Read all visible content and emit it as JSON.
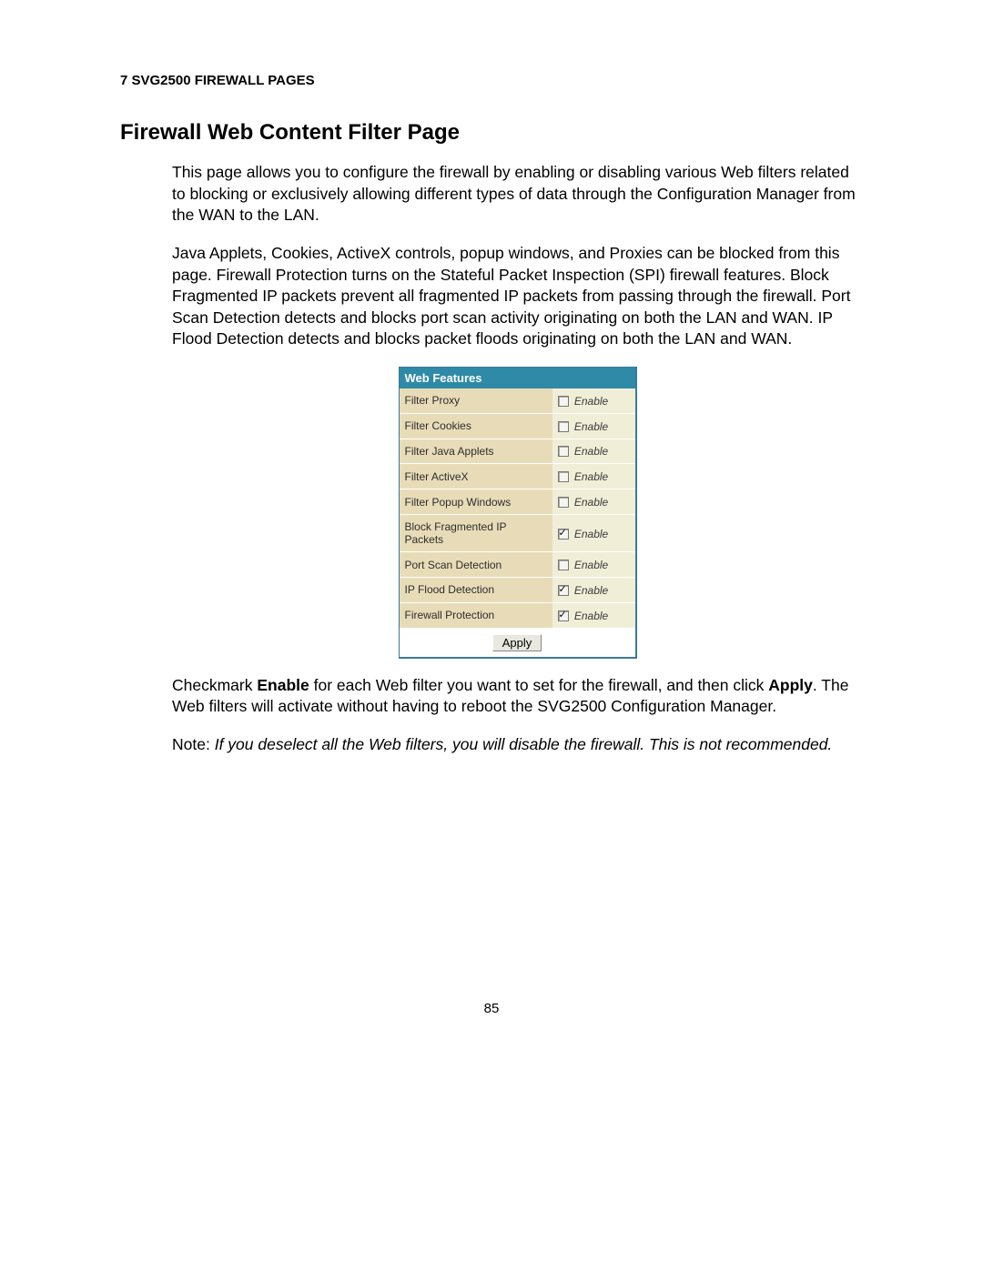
{
  "header": "7 SVG2500 FIREWALL PAGES",
  "title": "Firewall Web Content Filter Page",
  "para1": "This page allows you to configure the firewall by enabling or disabling various Web filters related to blocking or exclusively allowing different types of data through the Configuration Manager from the WAN to the LAN.",
  "para2": "Java Applets, Cookies, ActiveX controls, popup windows, and Proxies can be blocked from this page. Firewall Protection turns on the Stateful Packet Inspection (SPI) firewall features. Block Fragmented IP packets prevent all fragmented IP packets from passing through the firewall. Port Scan Detection detects and blocks port scan activity originating on both the LAN and WAN. IP Flood Detection detects and blocks packet floods originating on both the LAN and WAN.",
  "panel": {
    "header": "Web Features",
    "enable_label": "Enable",
    "apply_label": "Apply",
    "rows": [
      {
        "label": "Filter Proxy",
        "checked": false
      },
      {
        "label": "Filter Cookies",
        "checked": false
      },
      {
        "label": "Filter Java Applets",
        "checked": false
      },
      {
        "label": "Filter ActiveX",
        "checked": false
      },
      {
        "label": "Filter Popup Windows",
        "checked": false
      },
      {
        "label": "Block Fragmented IP Packets",
        "checked": true
      },
      {
        "label": "Port Scan Detection",
        "checked": false
      },
      {
        "label": "IP Flood Detection",
        "checked": true
      },
      {
        "label": "Firewall Protection",
        "checked": true
      }
    ]
  },
  "para3_pre": "Checkmark ",
  "para3_bold1": "Enable",
  "para3_mid": " for each Web filter you want to set for the firewall, and then click ",
  "para3_bold2": "Apply",
  "para3_post": ". The Web filters will activate without having to reboot the SVG2500 Configuration Manager.",
  "note_label": "Note: ",
  "note_text": "If you deselect all the Web filters, you will disable the firewall. This is not recommended.",
  "page_number": "85"
}
